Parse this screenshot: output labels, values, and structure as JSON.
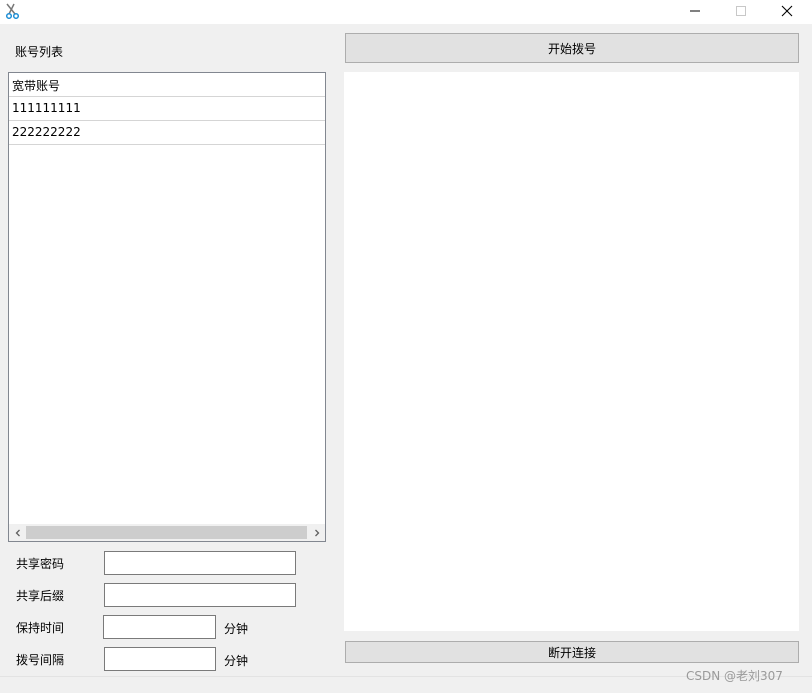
{
  "window": {
    "icon": "scissors-icon",
    "controls": {
      "minimize": "minimize-icon",
      "maximize": "maximize-icon",
      "close": "close-icon"
    }
  },
  "account_list": {
    "title": "账号列表",
    "column_header": "宽带账号",
    "rows": [
      "111111111",
      "222222222"
    ]
  },
  "form": {
    "share_password_label": "共享密码",
    "share_password_value": "",
    "share_suffix_label": "共享后缀",
    "share_suffix_value": "",
    "keep_time_label": "保持时间",
    "keep_time_value": "",
    "keep_time_unit": "分钟",
    "dial_interval_label": "拨号间隔",
    "dial_interval_value": "",
    "dial_interval_unit": "分钟"
  },
  "actions": {
    "start_dial_label": "开始拨号",
    "disconnect_label": "断开连接"
  },
  "watermark": "CSDN @老刘307",
  "colors": {
    "window_bg": "#f0f0f0",
    "button_bg": "#e1e1e1",
    "icon_accent": "#1e8fd6"
  }
}
